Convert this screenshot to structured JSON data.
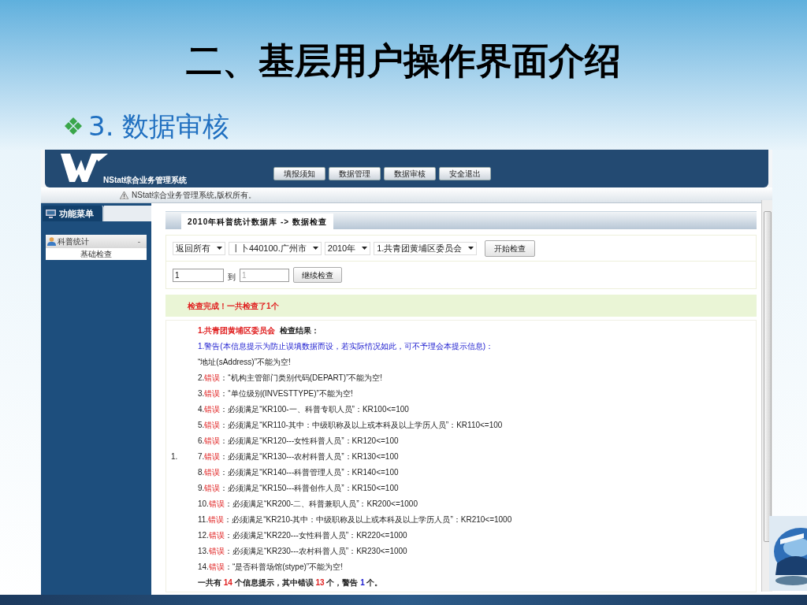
{
  "slide": {
    "title": "二、基层用户操作界面介绍",
    "subtitle": "3. 数据审核"
  },
  "app": {
    "system_name": "NStat综合业务管理系统",
    "nav": [
      {
        "label": "填报须知"
      },
      {
        "label": "数据管理"
      },
      {
        "label": "数据审核"
      },
      {
        "label": "安全退出"
      }
    ],
    "notice": "NStat综合业务管理系统,版权所有。",
    "sidebar": {
      "tab": "功能菜单",
      "group": {
        "label": "科普统计",
        "toggle": "-",
        "expanded": true,
        "items": [
          {
            "label": "基础检查"
          }
        ]
      }
    },
    "breadcrumb": "2010年科普统计数据库 -> 数据检查",
    "filters": [
      {
        "value": "返回所有"
      },
      {
        "value": "丨卜440100.广州市"
      },
      {
        "value": "2010年"
      },
      {
        "value": "1.共青团黄埔区委员会"
      }
    ],
    "start_button": "开始检查",
    "range": {
      "from": "1",
      "to_label": "到",
      "to_placeholder": "1",
      "button": "继续检查"
    },
    "banner": "检查完成！一共检查了1个",
    "results": [
      {
        "kind": "header",
        "number": "1.",
        "org": "共青团黄埔区委员会",
        "text": "检查结果："
      },
      {
        "kind": "warning",
        "number": "1.",
        "label": "警告(本信息提示为防止误填数据而设，若实际情况如此，可不予理会本提示信息)："
      },
      {
        "kind": "plain",
        "text": "“地址(sAddress)”不能为空!"
      },
      {
        "kind": "error",
        "number": "2.",
        "label": "错误",
        "text": "：“机构主管部门类别代码(DEPART)”不能为空!"
      },
      {
        "kind": "error",
        "number": "3.",
        "label": "错误",
        "text": "：“单位级别(INVESTTYPE)”不能为空!"
      },
      {
        "kind": "error",
        "number": "4.",
        "label": "错误",
        "text": "：必须满足“KR100-一、科普专职人员”：KR100<=100"
      },
      {
        "kind": "error",
        "number": "5.",
        "label": "错误",
        "text": "：必须满足“KR110-其中：中级职称及以上或本科及以上学历人员”：KR110<=100"
      },
      {
        "kind": "error",
        "number": "6.",
        "label": "错误",
        "text": "：必须满足“KR120---女性科普人员”：KR120<=100"
      },
      {
        "kind": "error",
        "number": "7.",
        "label": "错误",
        "text": "：必须满足“KR130---农村科普人员”：KR130<=100",
        "outer_number": "1."
      },
      {
        "kind": "error",
        "number": "8.",
        "label": "错误",
        "text": "：必须满足“KR140---科普管理人员”：KR140<=100"
      },
      {
        "kind": "error",
        "number": "9.",
        "label": "错误",
        "text": "：必须满足“KR150---科普创作人员”：KR150<=100"
      },
      {
        "kind": "error",
        "number": "10.",
        "label": "错误",
        "text": "：必须满足“KR200-二、科普兼职人员”：KR200<=1000"
      },
      {
        "kind": "error",
        "number": "11.",
        "label": "错误",
        "text": "：必须满足“KR210-其中：中级职称及以上或本科及以上学历人员”：KR210<=1000"
      },
      {
        "kind": "error",
        "number": "12.",
        "label": "错误",
        "text": "：必须满足“KR220---女性科普人员”：KR220<=1000"
      },
      {
        "kind": "error",
        "number": "13.",
        "label": "错误",
        "text": "：必须满足“KR230---农村科普人员”：KR230<=1000"
      },
      {
        "kind": "error",
        "number": "14.",
        "label": "错误",
        "text": "：“是否科普场馆(stype)”不能为空!"
      }
    ],
    "summary": {
      "prefix": "一共有",
      "total": "14",
      "middle": "个信息提示，其中错误",
      "errors": "13",
      "middle2": "个，警告",
      "warnings": "1",
      "suffix": "个。"
    }
  }
}
